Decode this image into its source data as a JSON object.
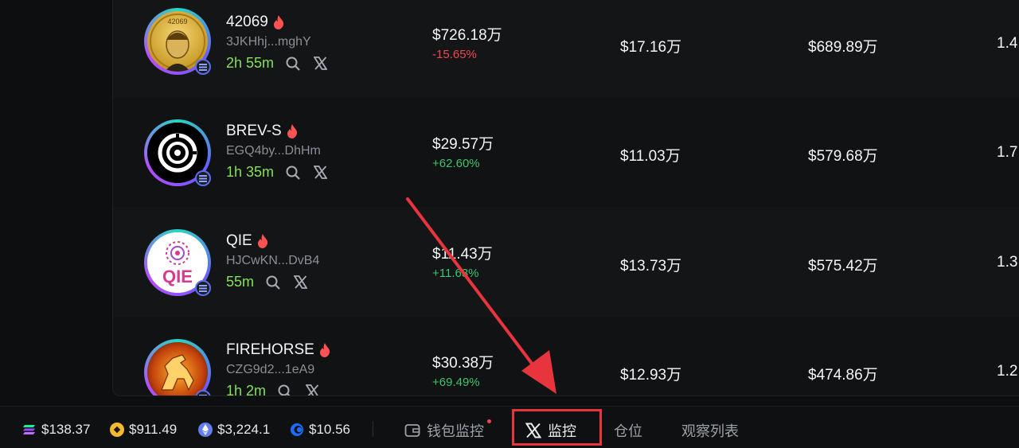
{
  "tokens": [
    {
      "name": "42069",
      "address": "3JKHhj...mghY",
      "age": "2h 55m",
      "price": "$726.18万",
      "change": "-15.65%",
      "change_dir": "neg",
      "col3": "$17.16万",
      "col4": "$689.89万",
      "col5": "1.4",
      "avatar_text": "42069",
      "avatar_icon": "elon-coin-avatar"
    },
    {
      "name": "BREV-S",
      "address": "EGQ4by...DhHm",
      "age": "1h 35m",
      "price": "$29.57万",
      "change": "+62.60%",
      "change_dir": "pos",
      "col3": "$11.03万",
      "col4": "$579.68万",
      "col5": "1.7",
      "avatar_icon": "target-logo-avatar"
    },
    {
      "name": "QIE",
      "address": "HJCwKN...DvB4",
      "age": "55m",
      "price": "$11.43万",
      "change": "+11.63%",
      "change_dir": "pos",
      "col3": "$13.73万",
      "col4": "$575.42万",
      "col5": "1.3",
      "avatar_text": "QIE",
      "avatar_icon": "qie-logo-avatar"
    },
    {
      "name": "FIREHORSE",
      "address": "CZG9d2...1eA9",
      "age": "1h 2m",
      "price": "$30.38万",
      "change": "+69.49%",
      "change_dir": "pos",
      "col3": "$12.93万",
      "col4": "$474.86万",
      "col5": "1.2",
      "avatar_icon": "fire-horse-avatar"
    }
  ],
  "tickers": [
    {
      "symbol_icon": "solana-icon",
      "price": "$138.37"
    },
    {
      "symbol_icon": "bnb-icon",
      "price": "$911.49"
    },
    {
      "symbol_icon": "ethereum-icon",
      "price": "$3,224.1"
    },
    {
      "symbol_icon": "base-icon",
      "price": "$10.56"
    }
  ],
  "nav": {
    "wallet_monitor": "钱包监控",
    "x_monitor": "监控",
    "positions": "仓位",
    "watchlist": "观察列表"
  },
  "colors": {
    "accent_green": "#86e05a",
    "up": "#3ec46d",
    "down": "#f0474f",
    "highlight": "#e8353d"
  }
}
